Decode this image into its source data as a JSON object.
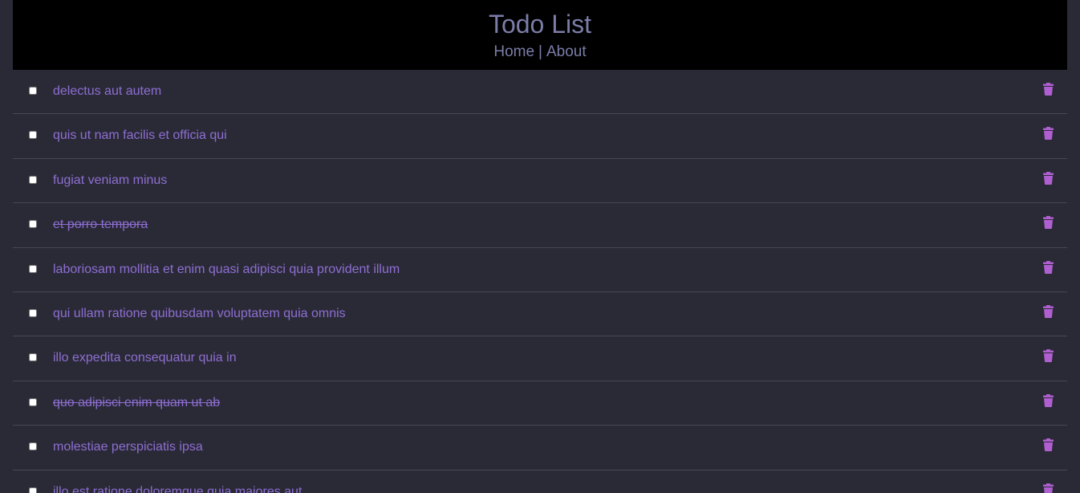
{
  "header": {
    "title": "Todo List",
    "nav": [
      {
        "label": "Home"
      },
      {
        "label": "About"
      }
    ],
    "separator": "|"
  },
  "todos": [
    {
      "text": "delectus aut autem",
      "completed": false
    },
    {
      "text": "quis ut nam facilis et officia qui",
      "completed": false
    },
    {
      "text": "fugiat veniam minus",
      "completed": false
    },
    {
      "text": "et porro tempora",
      "completed": true
    },
    {
      "text": "laboriosam mollitia et enim quasi adipisci quia provident illum",
      "completed": false
    },
    {
      "text": "qui ullam ratione quibusdam voluptatem quia omnis",
      "completed": false
    },
    {
      "text": "illo expedita consequatur quia in",
      "completed": false
    },
    {
      "text": "quo adipisci enim quam ut ab",
      "completed": true
    },
    {
      "text": "molestiae perspiciatis ipsa",
      "completed": false
    },
    {
      "text": "illo est ratione doloremque quia maiores aut",
      "completed": false
    }
  ],
  "icons": {
    "delete": "trash-icon"
  },
  "colors": {
    "background": "#2a2a37",
    "header_bg": "#000000",
    "header_text": "#7b7da8",
    "todo_text": "#8e6ed1",
    "trash": "#b05fd0",
    "divider": "#454555"
  }
}
